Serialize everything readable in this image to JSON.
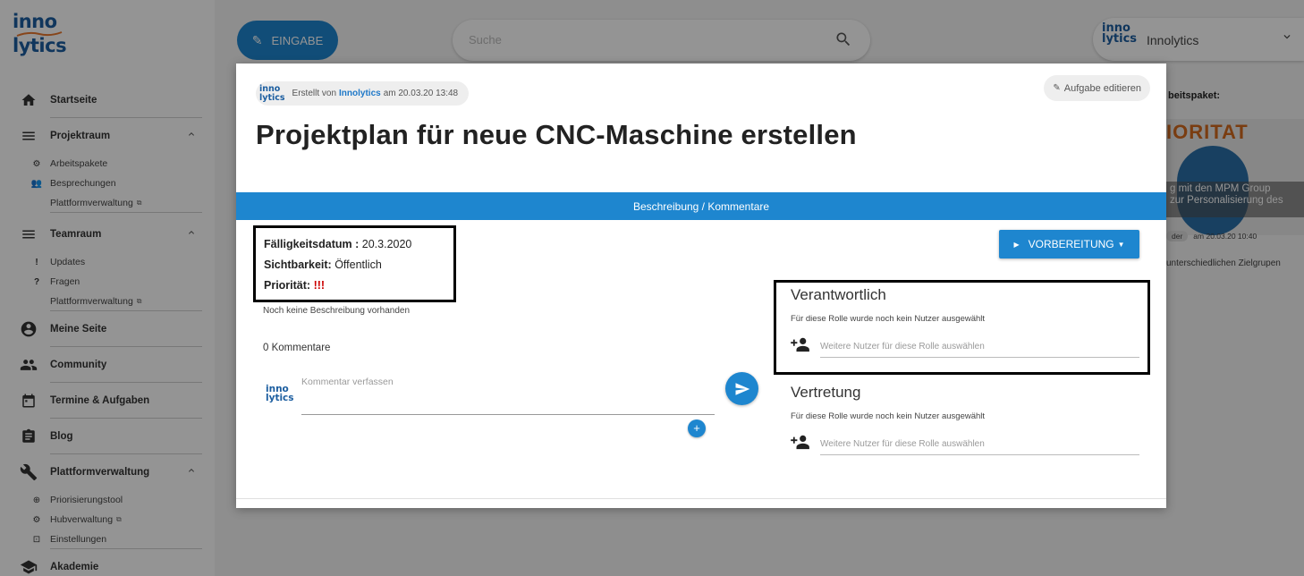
{
  "app": {
    "logo_line1": "inno",
    "logo_line2": "lytics",
    "eingabe_label": "EINGABE",
    "search_placeholder": "Suche",
    "user_name": "Innolytics"
  },
  "sidebar": {
    "items": [
      {
        "label": "Startseite",
        "icon": "home-icon"
      },
      {
        "label": "Projektraum",
        "icon": "menu-icon",
        "expanded": true,
        "subitems": [
          {
            "label": "Arbeitspakete",
            "icon": "workpackage-icon"
          },
          {
            "label": "Besprechungen",
            "icon": "meeting-icon"
          },
          {
            "label": "Plattformverwaltung",
            "icon": "",
            "external": true
          }
        ]
      },
      {
        "label": "Teamraum",
        "icon": "menu-icon",
        "expanded": true,
        "subitems": [
          {
            "label": "Updates",
            "icon": "exclamation-icon"
          },
          {
            "label": "Fragen",
            "icon": "question-icon"
          },
          {
            "label": "Plattformverwaltung",
            "icon": "",
            "external": true
          }
        ]
      },
      {
        "label": "Meine Seite",
        "icon": "account-icon"
      },
      {
        "label": "Community",
        "icon": "people-icon"
      },
      {
        "label": "Termine & Aufgaben",
        "icon": "calendar-icon"
      },
      {
        "label": "Blog",
        "icon": "clipboard-icon"
      },
      {
        "label": "Plattformverwaltung",
        "icon": "wrench-icon",
        "expanded": true,
        "subitems": [
          {
            "label": "Priorisierungstool",
            "icon": "target-icon"
          },
          {
            "label": "Hubverwaltung",
            "icon": "gear-icon",
            "external": true
          },
          {
            "label": "Einstellungen",
            "icon": "settings-icon"
          }
        ]
      },
      {
        "label": "Akademie",
        "icon": "graduation-icon"
      }
    ]
  },
  "right_card": {
    "label": "beitspaket:",
    "banner_title": "IORITAT",
    "banner_text_1": "g mit den MPM Group",
    "banner_text_2": "zur Personalisierung des",
    "meta_prefix": "der",
    "meta_date": "am 20.03.20 10:40",
    "desc": "unterschiedlichen Zielgrupen"
  },
  "modal": {
    "created_prefix": "Erstellt von",
    "created_by": "Innolytics",
    "created_at": "am 20.03.20 13:48",
    "edit_label": "Aufgabe editieren",
    "title": "Projektplan für neue CNC-Maschine erstellen",
    "tab_label": "Beschreibung / Kommentare",
    "due_label": "Fälligkeitsdatum :",
    "due_value": "20.3.2020",
    "visibility_label": "Sichtbarkeit:",
    "visibility_value": "Öffentlich",
    "priority_label": "Priorität:",
    "priority_value": "!!!",
    "no_description": "Noch keine Beschreibung vorhanden",
    "comments_count": "0 Kommentare",
    "comment_placeholder": "Kommentar verfassen",
    "status_label": "VORBEREITUNG",
    "roles": [
      {
        "title": "Verantwortlich",
        "subtitle": "Für diese Rolle wurde noch kein Nutzer ausgewählt",
        "placeholder": "Weitere Nutzer für diese Rolle auswählen"
      },
      {
        "title": "Vertretung",
        "subtitle": "Für diese Rolle wurde noch kein Nutzer ausgewählt",
        "placeholder": "Weitere Nutzer für diese Rolle auswählen"
      }
    ]
  },
  "colors": {
    "primary": "#1e86cf",
    "brand": "#1c5ea0",
    "priority": "#cc0000"
  }
}
